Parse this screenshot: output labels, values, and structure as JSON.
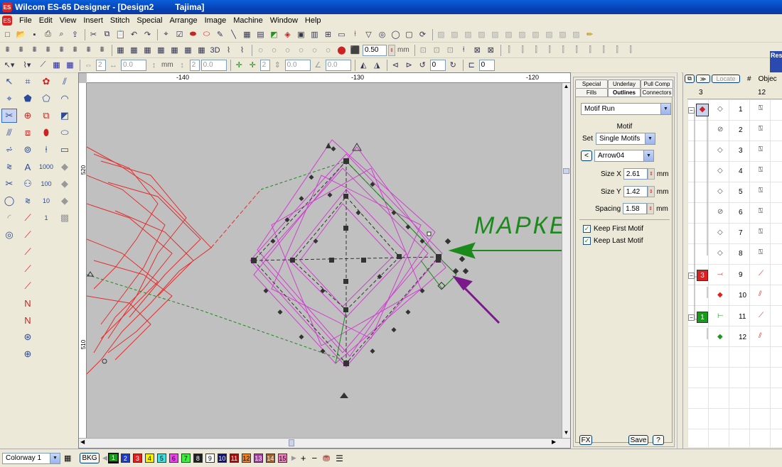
{
  "window": {
    "title": "Wilcom ES-65 Designer - [Design2         Tajima]",
    "app_icon": "ES"
  },
  "menu": [
    "File",
    "Edit",
    "View",
    "Insert",
    "Stitch",
    "Special",
    "Arrange",
    "Image",
    "Machine",
    "Window",
    "Help"
  ],
  "toolbar": {
    "spacing_value": "0.50",
    "spacing_unit": "mm",
    "tb3_field1": "2",
    "tb3_field2": "0.0",
    "tb3_unit1": "mm",
    "tb3_field3": "2",
    "tb3_field4": "0.0",
    "tb3_field5": "2",
    "tb3_field6": "0.0",
    "tb3_field7": "0.0",
    "rotate_value1": "0",
    "rotate_value2": "0"
  },
  "ruler": {
    "h_labels": [
      "-140",
      "-130",
      "-120"
    ],
    "v_labels": [
      "520",
      "510"
    ]
  },
  "canvas": {
    "annotation_text": "МАРКЕР",
    "annotation_color": "#1a8a1a",
    "arrow_color": "#7a1a8a"
  },
  "object_properties": {
    "tabs_row1": [
      "Special",
      "Underlay",
      "Pull Comp"
    ],
    "tabs_row2": [
      "Fills",
      "Outlines",
      "Connectors"
    ],
    "active_tab": "Outlines",
    "outline_type": "Motif Run",
    "motif_label": "Motif",
    "set_label": "Set",
    "set_value": "Single Motifs",
    "motif_value": "Arrow04",
    "size_x_label": "Size X",
    "size_x_value": "2.61",
    "size_y_label": "Size Y",
    "size_y_value": "1.42",
    "spacing_label": "Spacing",
    "spacing_value": "1.58",
    "unit": "mm",
    "keep_first_label": "Keep First Motif",
    "keep_first_checked": true,
    "keep_last_label": "Keep Last Motif",
    "keep_last_checked": true,
    "fx_button": "FX",
    "save_button": "Save",
    "help_button": "?"
  },
  "sequence": {
    "locate_button": "Locate",
    "col_hash": "#",
    "col_object": "Objec",
    "header_left": "3",
    "header_right": "12",
    "panel_tab": "Res",
    "rows": [
      {
        "num": "1",
        "group": ""
      },
      {
        "num": "2",
        "group": ""
      },
      {
        "num": "3",
        "group": ""
      },
      {
        "num": "4",
        "group": ""
      },
      {
        "num": "5",
        "group": ""
      },
      {
        "num": "6",
        "group": ""
      },
      {
        "num": "7",
        "group": ""
      },
      {
        "num": "8",
        "group": ""
      },
      {
        "num": "9",
        "group": "3",
        "group_color": "#e02020"
      },
      {
        "num": "10",
        "group": ""
      },
      {
        "num": "11",
        "group": "1",
        "group_color": "#1a9a1a"
      },
      {
        "num": "12",
        "group": ""
      }
    ]
  },
  "status": {
    "colorway": "Colorway 1",
    "bkg": "BKG",
    "colors": [
      {
        "n": "1",
        "c": "#1a9a1a"
      },
      {
        "n": "2",
        "c": "#1a3ad0"
      },
      {
        "n": "3",
        "c": "#e02020"
      },
      {
        "n": "4",
        "c": "#f4f000"
      },
      {
        "n": "5",
        "c": "#40e0e0"
      },
      {
        "n": "6",
        "c": "#f040f0"
      },
      {
        "n": "7",
        "c": "#40f040"
      },
      {
        "n": "8",
        "c": "#202020"
      },
      {
        "n": "9",
        "c": "#ffffff"
      },
      {
        "n": "10",
        "c": "#101070"
      },
      {
        "n": "11",
        "c": "#a01010"
      },
      {
        "n": "12",
        "c": "#f08020"
      },
      {
        "n": "13",
        "c": "#a040a0"
      },
      {
        "n": "14",
        "c": "#a06030"
      },
      {
        "n": "15",
        "c": "#f080c0"
      }
    ]
  }
}
